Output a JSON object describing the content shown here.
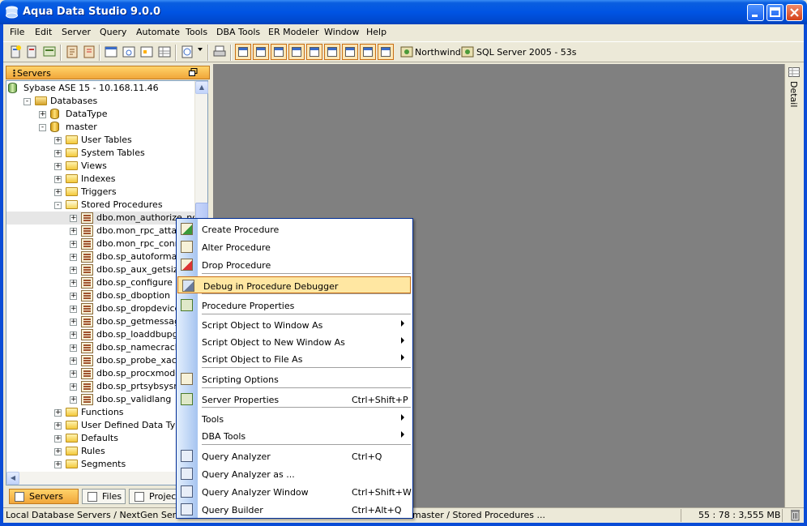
{
  "window": {
    "title": "Aqua Data Studio 9.0.0"
  },
  "menubar": {
    "items": [
      "File",
      "Edit",
      "Server",
      "Query",
      "Automate",
      "Tools",
      "DBA Tools",
      "ER Modeler",
      "Window",
      "Help"
    ]
  },
  "toolbar": {
    "connection_1": "Northwind",
    "connection_2": "SQL Server 2005 - 53s"
  },
  "servers_panel": {
    "title": "Servers",
    "tree": [
      {
        "label": "Sybase ASE 15 - 10.168.11.46",
        "icon": "server-icon"
      },
      {
        "label": "Databases",
        "icon": "database-folder-icon",
        "expander": "-"
      },
      {
        "label": "DataType",
        "icon": "database-icon",
        "expander": "+"
      },
      {
        "label": "master",
        "icon": "database-icon",
        "expander": "-"
      },
      {
        "label": "User Tables",
        "icon": "folder-icon",
        "expander": "+"
      },
      {
        "label": "System Tables",
        "icon": "folder-icon",
        "expander": "+"
      },
      {
        "label": "Views",
        "icon": "folder-icon",
        "expander": "+"
      },
      {
        "label": "Indexes",
        "icon": "folder-icon",
        "expander": "+"
      },
      {
        "label": "Triggers",
        "icon": "folder-icon",
        "expander": "+"
      },
      {
        "label": "Stored Procedures",
        "icon": "folder-open-icon",
        "expander": "-"
      },
      {
        "label": "dbo.mon_authorize_non_sa",
        "icon": "procedure-icon",
        "expander": "+"
      },
      {
        "label": "dbo.mon_rpc_attach",
        "icon": "procedure-icon",
        "expander": "+"
      },
      {
        "label": "dbo.mon_rpc_connect",
        "icon": "procedure-icon",
        "expander": "+"
      },
      {
        "label": "dbo.sp_autoformat",
        "icon": "procedure-icon",
        "expander": "+"
      },
      {
        "label": "dbo.sp_aux_getsize",
        "icon": "procedure-icon",
        "expander": "+"
      },
      {
        "label": "dbo.sp_configure",
        "icon": "procedure-icon",
        "expander": "+"
      },
      {
        "label": "dbo.sp_dboption",
        "icon": "procedure-icon",
        "expander": "+"
      },
      {
        "label": "dbo.sp_dropdevice",
        "icon": "procedure-icon",
        "expander": "+"
      },
      {
        "label": "dbo.sp_getmessage",
        "icon": "procedure-icon",
        "expander": "+"
      },
      {
        "label": "dbo.sp_loaddbupgrade",
        "icon": "procedure-icon",
        "expander": "+"
      },
      {
        "label": "dbo.sp_namecrack",
        "icon": "procedure-icon",
        "expander": "+"
      },
      {
        "label": "dbo.sp_probe_xact",
        "icon": "procedure-icon",
        "expander": "+"
      },
      {
        "label": "dbo.sp_procxmode",
        "icon": "procedure-icon",
        "expander": "+"
      },
      {
        "label": "dbo.sp_prtsybsysmsgs",
        "icon": "procedure-icon",
        "expander": "+"
      },
      {
        "label": "dbo.sp_validlang",
        "icon": "procedure-icon",
        "expander": "+"
      },
      {
        "label": "Functions",
        "icon": "folder-icon",
        "expander": "+"
      },
      {
        "label": "User Defined Data Types",
        "icon": "folder-icon",
        "expander": "+"
      },
      {
        "label": "Defaults",
        "icon": "folder-icon",
        "expander": "+"
      },
      {
        "label": "Rules",
        "icon": "folder-icon",
        "expander": "+"
      },
      {
        "label": "Segments",
        "icon": "folder-icon",
        "expander": "+"
      }
    ],
    "tabs": [
      "Servers",
      "Files",
      "Projects"
    ]
  },
  "right_dock": {
    "detail_label": "Detail"
  },
  "context_menu": {
    "items": [
      {
        "label": "Create Procedure",
        "shortcut": "",
        "submenu": false,
        "icon": "create-procedure-icon"
      },
      {
        "label": "Alter Procedure",
        "shortcut": "",
        "submenu": false,
        "icon": "alter-procedure-icon"
      },
      {
        "label": "Drop Procedure",
        "shortcut": "",
        "submenu": false,
        "icon": "drop-procedure-icon"
      },
      {
        "label": "Debug in Procedure Debugger",
        "shortcut": "",
        "submenu": false,
        "icon": "debug-icon",
        "highlighted": true
      },
      {
        "label": "Procedure Properties",
        "shortcut": "",
        "submenu": false,
        "icon": "properties-icon"
      },
      {
        "label": "Script Object to Window As",
        "shortcut": "",
        "submenu": true
      },
      {
        "label": "Script Object to New Window As",
        "shortcut": "",
        "submenu": true
      },
      {
        "label": "Script Object to File As",
        "shortcut": "",
        "submenu": true
      },
      {
        "label": "Scripting Options",
        "shortcut": "",
        "submenu": false,
        "icon": "scripting-options-icon"
      },
      {
        "label": "Server Properties",
        "shortcut": "Ctrl+Shift+P",
        "submenu": false,
        "icon": "server-properties-icon"
      },
      {
        "label": "Tools",
        "shortcut": "",
        "submenu": true
      },
      {
        "label": "DBA Tools",
        "shortcut": "",
        "submenu": true
      },
      {
        "label": "Query Analyzer",
        "shortcut": "Ctrl+Q",
        "submenu": false,
        "icon": "query-analyzer-icon"
      },
      {
        "label": "Query Analyzer as ...",
        "shortcut": "",
        "submenu": false,
        "icon": "query-analyzer-as-icon"
      },
      {
        "label": "Query Analyzer Window",
        "shortcut": "Ctrl+Shift+W",
        "submenu": false,
        "icon": "query-analyzer-window-icon"
      },
      {
        "label": "Query Builder",
        "shortcut": "Ctrl+Alt+Q",
        "submenu": false,
        "icon": "query-builder-icon"
      }
    ]
  },
  "statusbar": {
    "left": "Local Database Servers / NextGen Servers",
    "middle": "master / Stored Procedures ...",
    "memory": "55 : 78 : 3,555 MB"
  }
}
